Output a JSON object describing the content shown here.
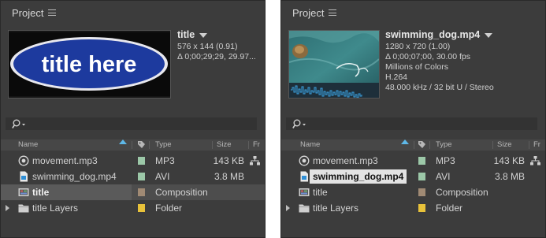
{
  "panels": [
    {
      "title": "Project",
      "thumbnail": {
        "kind": "title-card",
        "text": "title here",
        "ellipse_color": "#1d3a9e",
        "text_color": "#ffffff"
      },
      "info": {
        "name": "title",
        "line1": "576 x 144 (0.91)",
        "line2": "Δ 0;00;29;29, 29.97...",
        "line3": "",
        "line4": "",
        "line5": ""
      },
      "columns": {
        "name": "Name",
        "type": "Type",
        "size": "Size",
        "extra": "Fr"
      },
      "rows": [
        {
          "name": "movement.mp3",
          "icon": "audio-file-icon",
          "label_color": "#9cc8a8",
          "type": "MP3",
          "size": "143 KB",
          "share": true
        },
        {
          "name": "swimming_dog.mp4",
          "icon": "video-file-icon",
          "label_color": "#9cc8a8",
          "type": "AVI",
          "size": "3.8 MB",
          "share": false
        },
        {
          "name": "title",
          "icon": "composition-icon",
          "label_color": "#a08a74",
          "type": "Composition",
          "size": "",
          "share": false,
          "selected": true
        },
        {
          "name": "title Layers",
          "icon": "folder-icon",
          "label_color": "#e8c23a",
          "type": "Folder",
          "size": "",
          "share": false,
          "expandable": true
        }
      ]
    },
    {
      "title": "Project",
      "thumbnail": {
        "kind": "video-frame"
      },
      "info": {
        "name": "swimming_dog.mp4",
        "line1": "1280 x 720 (1.00)",
        "line2": "Δ 0;00;07;00, 30.00 fps",
        "line3": "Millions of Colors",
        "line4": "H.264",
        "line5": "48.000 kHz / 32 bit U / Stereo"
      },
      "columns": {
        "name": "Name",
        "type": "Type",
        "size": "Size",
        "extra": "Fr"
      },
      "rows": [
        {
          "name": "movement.mp3",
          "icon": "audio-file-icon",
          "label_color": "#9cc8a8",
          "type": "MP3",
          "size": "143 KB",
          "share": true
        },
        {
          "name": "swimming_dog.mp4",
          "icon": "video-file-icon",
          "label_color": "#9cc8a8",
          "type": "AVI",
          "size": "3.8 MB",
          "share": false,
          "selected": true
        },
        {
          "name": "title",
          "icon": "composition-icon",
          "label_color": "#a08a74",
          "type": "Composition",
          "size": "",
          "share": false
        },
        {
          "name": "title Layers",
          "icon": "folder-icon",
          "label_color": "#e8c23a",
          "type": "Folder",
          "size": "",
          "share": false,
          "expandable": true
        }
      ]
    }
  ]
}
